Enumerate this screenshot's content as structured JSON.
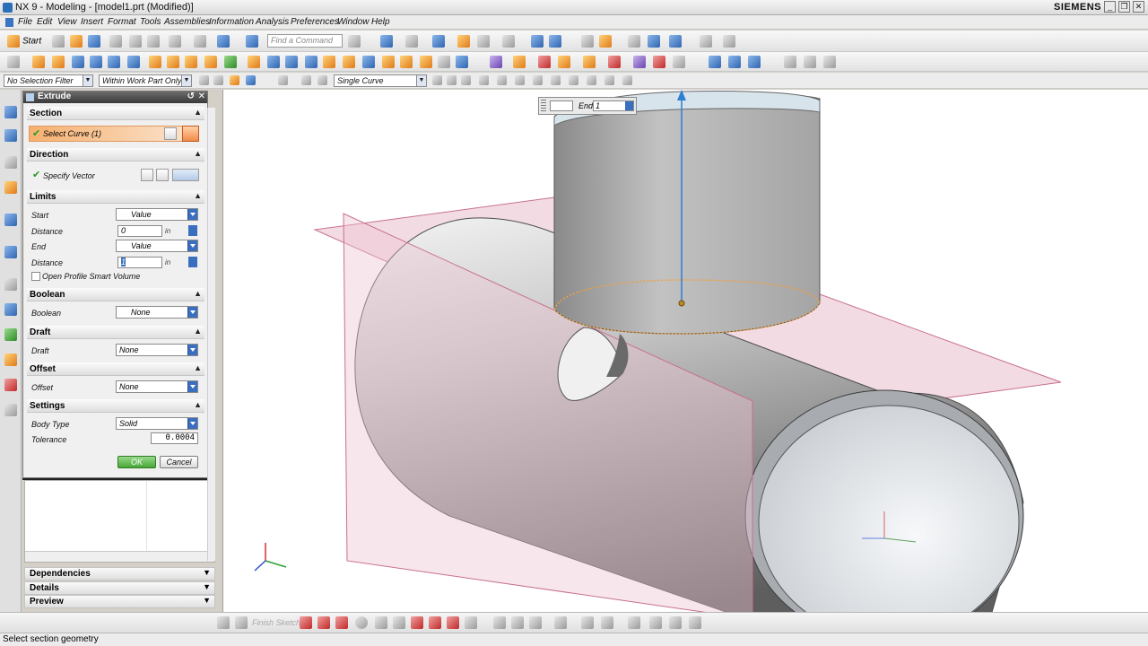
{
  "window": {
    "title": "NX 9 - Modeling - [model1.prt (Modified)]",
    "brand": "SIEMENS"
  },
  "menu": [
    "File",
    "Edit",
    "View",
    "Insert",
    "Format",
    "Tools",
    "Assemblies",
    "Information",
    "Analysis",
    "Preferences",
    "Window",
    "Help"
  ],
  "toolbar": {
    "start_label": "Start",
    "command_search_placeholder": "Find a Command",
    "selection_filter": "No Selection Filter",
    "selection_scope": "Within Work Part Only",
    "curve_rule": "Single Curve"
  },
  "dialog": {
    "title": "Extrude",
    "sections": {
      "section": "Section",
      "direction": "Direction",
      "limits": "Limits",
      "boolean": "Boolean",
      "draft": "Draft",
      "offset": "Offset",
      "settings": "Settings"
    },
    "select_curve": "Select Curve (1)",
    "specify_vector": "Specify Vector",
    "start_label": "Start",
    "start_value": "Value",
    "start_distance_label": "Distance",
    "start_distance": "0",
    "end_label": "End",
    "end_value": "Value",
    "end_distance_label": "Distance",
    "end_distance": "1",
    "unit": "in",
    "open_profile": "Open Profile Smart Volume",
    "boolean_label": "Boolean",
    "boolean_value": "None",
    "draft_label": "Draft",
    "draft_value": "None",
    "offset_label": "Offset",
    "offset_value": "None",
    "body_type_label": "Body Type",
    "body_type_value": "Solid",
    "tolerance_label": "Tolerance",
    "tolerance_value": "0.0004",
    "ok": "OK",
    "cancel": "Cancel"
  },
  "navigator": {
    "dependencies": "Dependencies",
    "details": "Details",
    "preview": "Preview"
  },
  "viewport": {
    "end_label": "End",
    "end_value": "1"
  },
  "bottom_toolbar": {
    "finish_sketch": "Finish Sketch"
  },
  "status": "Select section geometry",
  "colors": {
    "selection_orange": "#f5b070",
    "plane_pink": "#e8a6bc",
    "ok_green": "#48a838",
    "vector_blue": "#2f7fd0"
  }
}
